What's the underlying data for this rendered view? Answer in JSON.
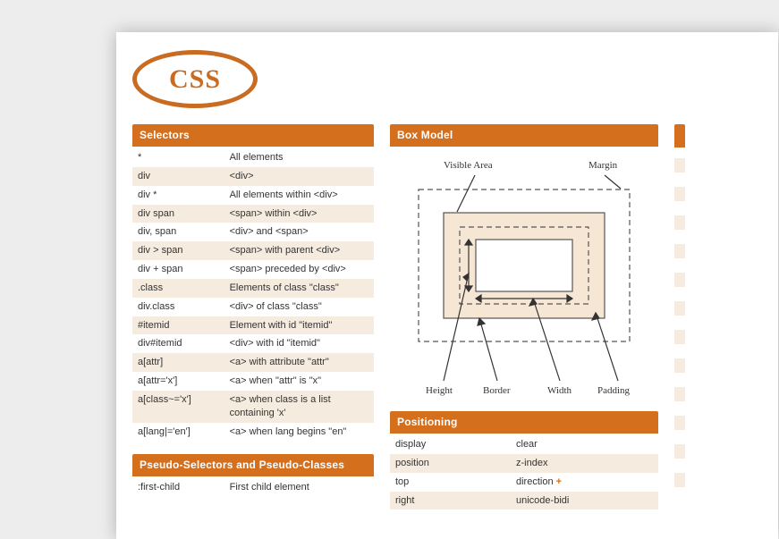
{
  "logo": {
    "text": "CSS"
  },
  "selectors": {
    "title": "Selectors",
    "rows": [
      {
        "k": "*",
        "v": "All elements"
      },
      {
        "k": "div",
        "v": "<div>"
      },
      {
        "k": "div *",
        "v": "All elements within <div>"
      },
      {
        "k": "div span",
        "v": "<span> within <div>"
      },
      {
        "k": "div, span",
        "v": "<div> and <span>"
      },
      {
        "k": "div > span",
        "v": "<span> with parent <div>"
      },
      {
        "k": "div + span",
        "v": "<span> preceded by <div>"
      },
      {
        "k": ".class",
        "v": "Elements of class \"class\""
      },
      {
        "k": "div.class",
        "v": "<div> of class \"class\""
      },
      {
        "k": "#itemid",
        "v": "Element with id \"itemid\""
      },
      {
        "k": "div#itemid",
        "v": "<div> with id \"itemid\""
      },
      {
        "k": "a[attr]",
        "v": "<a> with attribute \"attr\""
      },
      {
        "k": "a[attr='x']",
        "v": "<a> when \"attr\" is \"x\""
      },
      {
        "k": "a[class~='x']",
        "v": "<a> when class is a list containing 'x'"
      },
      {
        "k": "a[lang|='en']",
        "v": "<a> when lang begins \"en\""
      }
    ]
  },
  "pseudo": {
    "title": "Pseudo-Selectors and Pseudo-Classes",
    "rows": [
      {
        "k": ":first-child",
        "v": "First child element"
      }
    ]
  },
  "boxmodel": {
    "title": "Box Model",
    "labels": {
      "visible": "Visible Area",
      "margin": "Margin",
      "height": "Height",
      "border": "Border",
      "width": "Width",
      "padding": "Padding"
    }
  },
  "positioning": {
    "title": "Positioning",
    "rows": [
      {
        "k": "display",
        "v": "clear"
      },
      {
        "k": "position",
        "v": "z-index"
      },
      {
        "k": "top",
        "v": "direction",
        "plus": true
      },
      {
        "k": "right",
        "v": "unicode-bidi"
      }
    ]
  }
}
